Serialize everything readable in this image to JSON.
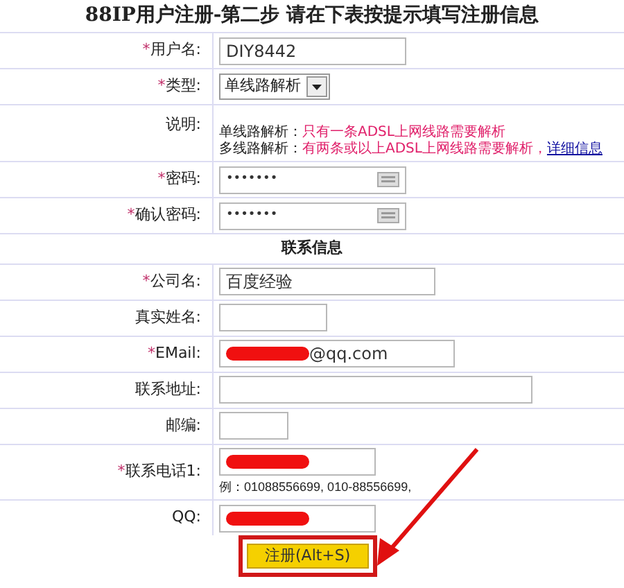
{
  "title": "88IP用户注册-第二步  请在下表按提示填写注册信息",
  "rows": [
    {
      "kind": "text",
      "mark": "*",
      "label": "用户名:",
      "value": "DIY8442"
    },
    {
      "kind": "select",
      "mark": "*",
      "label": "类型:",
      "value": "单线路解析"
    },
    {
      "kind": "note",
      "label": "说明:",
      "lines": [
        {
          "term": "单线路解析：",
          "text": "只有一条ADSL上网线路需要解析"
        },
        {
          "term": "多线路解析：",
          "text": "有两条或以上ADSL上网线路需要解析，",
          "link": "详细信息"
        }
      ]
    },
    {
      "kind": "password",
      "mark": "*",
      "label": "密码:",
      "value": "•••••••"
    },
    {
      "kind": "password",
      "mark": "*",
      "label": "确认密码:",
      "value": "•••••••"
    },
    {
      "kind": "section",
      "label": "联系信息"
    },
    {
      "kind": "text",
      "mark": "*",
      "label": "公司名:",
      "value": "百度经验"
    },
    {
      "kind": "text",
      "label": "真实姓名:"
    },
    {
      "kind": "text",
      "mark": "*",
      "label": "EMail:",
      "value": "@qq.com",
      "redacted": true
    },
    {
      "kind": "text",
      "label": "联系地址:"
    },
    {
      "kind": "text",
      "label": "邮编:"
    },
    {
      "kind": "text",
      "mark": "*",
      "label": "联系电话1:",
      "redacted": true,
      "hint": "例：01088556699, 010-88556699,"
    },
    {
      "kind": "text",
      "label": "QQ:",
      "redacted": true
    }
  ],
  "submit": {
    "label": "注册(Alt+S)",
    "highlighted": true
  }
}
